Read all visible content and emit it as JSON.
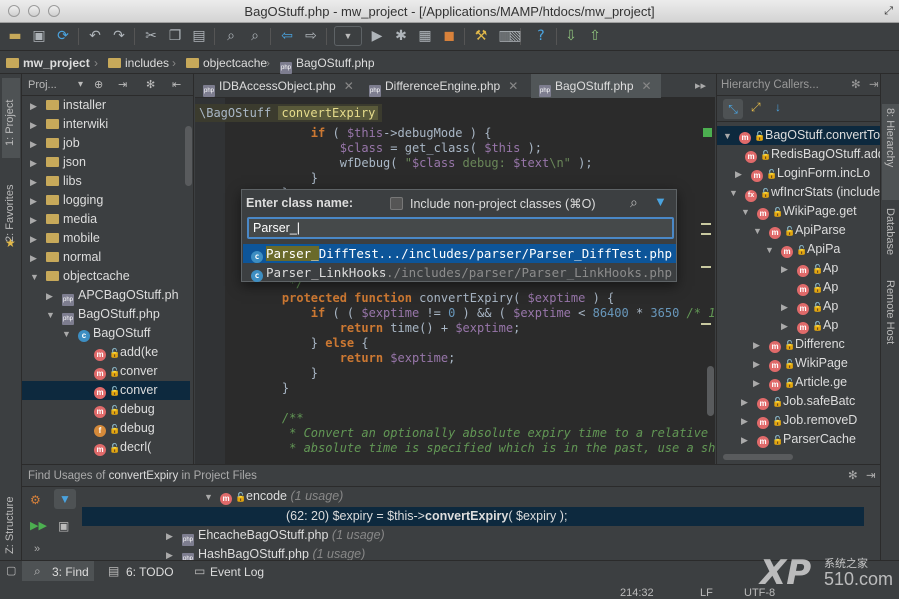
{
  "window": {
    "title": "BagOStuff.php - mw_project - [/Applications/MAMP/htdocs/mw_project]"
  },
  "navbar": {
    "crumbs": [
      "mw_project",
      "includes",
      "objectcache",
      "BagOStuff.php"
    ]
  },
  "project_panel": {
    "header_label": "Proj...",
    "tree": [
      {
        "label": "installer",
        "type": "folder"
      },
      {
        "label": "interwiki",
        "type": "folder"
      },
      {
        "label": "job",
        "type": "folder"
      },
      {
        "label": "json",
        "type": "folder"
      },
      {
        "label": "libs",
        "type": "folder"
      },
      {
        "label": "logging",
        "type": "folder"
      },
      {
        "label": "media",
        "type": "folder"
      },
      {
        "label": "mobile",
        "type": "folder"
      },
      {
        "label": "normal",
        "type": "folder"
      },
      {
        "label": "objectcache",
        "type": "folder"
      },
      {
        "label": "APCBagOStuff.ph",
        "type": "php"
      },
      {
        "label": "BagOStuff.php",
        "type": "php"
      },
      {
        "label": "BagOStuff",
        "type": "class"
      },
      {
        "label": "add(ke",
        "type": "method"
      },
      {
        "label": "conver",
        "type": "method"
      },
      {
        "label": "conver",
        "type": "method"
      },
      {
        "label": "debug",
        "type": "method"
      },
      {
        "label": "debug",
        "type": "field"
      },
      {
        "label": "decrl(",
        "type": "method"
      }
    ]
  },
  "left_strip": {
    "project_label": "1: Project",
    "favorites_label": "2: Favorites",
    "structure_label": "Z: Structure"
  },
  "right_strip": {
    "hierarchy_label": "8: Hierarchy",
    "database_label": "Database",
    "remote_label": "Remote Host"
  },
  "editor_tabs": [
    {
      "label": "IDBAccessObject.php",
      "active": false
    },
    {
      "label": "DifferenceEngine.php",
      "active": false
    },
    {
      "label": "BagOStuff.php",
      "active": true
    }
  ],
  "editor": {
    "breadcrumb_class": "\\BagOStuff",
    "breadcrumb_method": "convertExpiry"
  },
  "popup": {
    "title": "Enter class name:",
    "checkbox_label": "Include non-project classes (⌘O)",
    "input_value": "Parser_",
    "results": [
      {
        "name_highlight": "Parser_",
        "name_rest": "DiffTest",
        "path": ".../includes/parser/Parser_DiffTest.php",
        "selected": true
      },
      {
        "name_highlight": "Parser_",
        "name_rest": "LinkHooks",
        "path": ".../includes/parser/Parser_LinkHooks.php",
        "selected": false
      }
    ]
  },
  "hierarchy_panel": {
    "title": "Hierarchy Callers...",
    "items": [
      "BagOStuff.convertToR",
      "RedisBagOStuff.add",
      "LoginForm.incLo",
      "wfIncrStats (include",
      "WikiPage.get",
      "ApiParse",
      "ApiPa",
      "Ap",
      "Ap",
      "Ap",
      "Ap",
      "Differenc",
      "WikiPage",
      "Article.ge",
      "Job.safeBatc",
      "Job.removeD",
      "ParserCache"
    ]
  },
  "find_panel": {
    "title_prefix": "Find Usages of",
    "title_target": "convertExpiry",
    "title_suffix": "in Project Files",
    "encode_label": "encode",
    "encode_usage": "(1 usage)",
    "selected_line": "(62: 20)",
    "selected_code_a": "$expiry = $this->",
    "selected_code_b": "convertExpiry",
    "selected_code_c": "( $expiry );",
    "file1": "EhcacheBagOStuff.php",
    "file1_usage": "(1 usage)",
    "file2": "HashBagOStuff.php",
    "file2_usage": "(1 usage)"
  },
  "bottom": {
    "find_label": "3: Find",
    "todo_label": "6: TODO",
    "eventlog_label": "Event Log",
    "position": "214:32",
    "line_sep": "LF",
    "encoding": "UTF-8"
  },
  "watermark": {
    "text": "系统之家",
    "domain": "510.com"
  },
  "colors": {
    "accent": "#4a88c7",
    "selection": "#0d293e",
    "keyword": "#cc7832",
    "string": "#6a8759",
    "variable": "#9876aa",
    "comment": "#629755"
  }
}
